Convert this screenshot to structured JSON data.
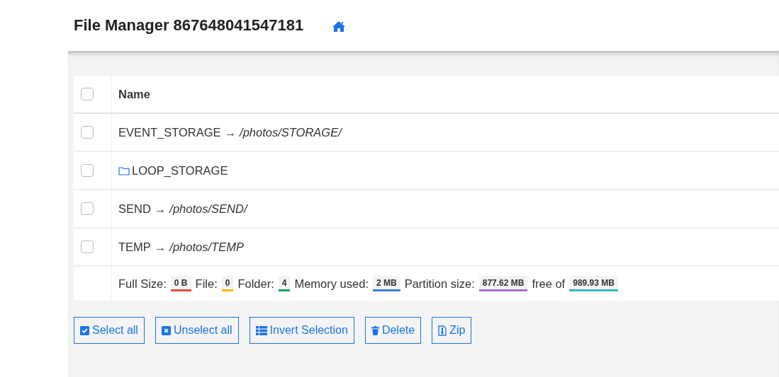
{
  "title": "File Manager 867648041547181",
  "table": {
    "header": {
      "label": "Name",
      "checked": false
    },
    "rows": [
      {
        "kind": "link",
        "name": "EVENT_STORAGE",
        "arrow": "→",
        "target": "/photos/STORAGE/",
        "checked": false
      },
      {
        "kind": "folder",
        "name": "LOOP_STORAGE",
        "checked": false
      },
      {
        "kind": "link",
        "name": "SEND",
        "arrow": "→",
        "target": "/photos/SEND/",
        "checked": false
      },
      {
        "kind": "link",
        "name": "TEMP",
        "arrow": "→",
        "target": "/photos/TEMP",
        "checked": false
      }
    ],
    "summary": [
      {
        "label": "Full Size:",
        "value": "0 B",
        "color": "#e74c3c"
      },
      {
        "label": "File:",
        "value": "0",
        "color": "#f5b800"
      },
      {
        "label": "Folder:",
        "value": "4",
        "color": "#18a558"
      },
      {
        "label": "Memory used:",
        "value": "2 MB",
        "color": "#3b7ddd"
      },
      {
        "label": "Partition size:",
        "value": "877.62 MB",
        "color": "#a66bdd"
      },
      {
        "label": "free of",
        "value": "989.93 MB",
        "color": "#39b8c6"
      }
    ]
  },
  "buttons": [
    {
      "kind": "check",
      "label": "Select all"
    },
    {
      "kind": "uncheck",
      "label": "Unselect all"
    },
    {
      "kind": "list",
      "label": "Invert Selection"
    },
    {
      "kind": "trash",
      "label": "Delete"
    },
    {
      "kind": "zip",
      "label": "Zip"
    }
  ]
}
